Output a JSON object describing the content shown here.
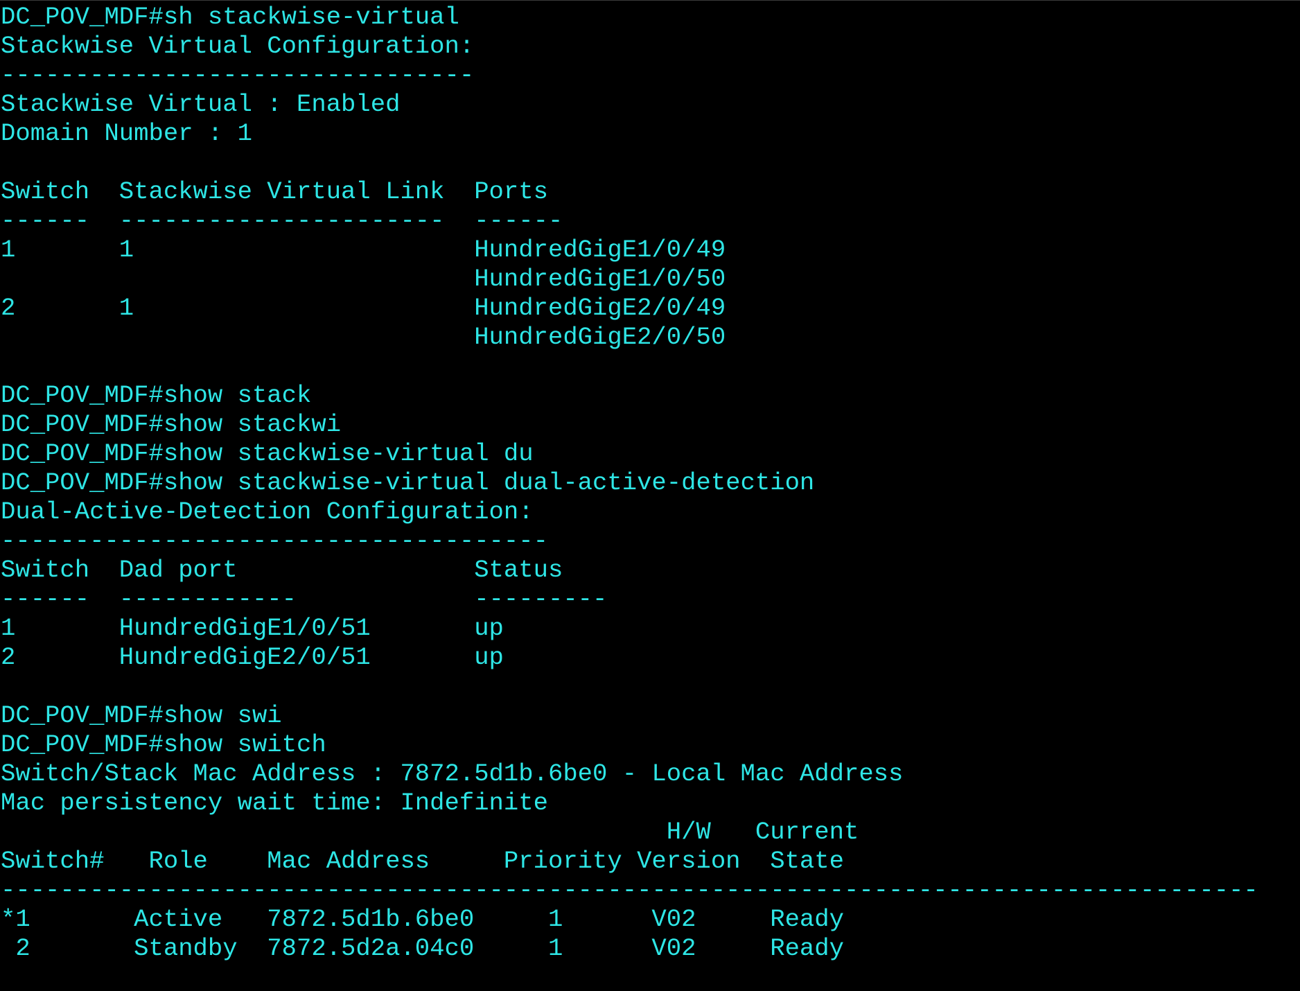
{
  "terminal": {
    "lines": [
      "DC_POV_MDF#sh stackwise-virtual",
      "Stackwise Virtual Configuration:",
      "--------------------------------",
      "Stackwise Virtual : Enabled",
      "Domain Number : 1",
      "",
      "Switch  Stackwise Virtual Link  Ports",
      "------  ----------------------  ------",
      "1       1                       HundredGigE1/0/49",
      "                                HundredGigE1/0/50",
      "2       1                       HundredGigE2/0/49",
      "                                HundredGigE2/0/50",
      "",
      "DC_POV_MDF#show stack",
      "DC_POV_MDF#show stackwi",
      "DC_POV_MDF#show stackwise-virtual du",
      "DC_POV_MDF#show stackwise-virtual dual-active-detection",
      "Dual-Active-Detection Configuration:",
      "-------------------------------------",
      "Switch  Dad port                Status",
      "------  ------------            ---------",
      "1       HundredGigE1/0/51       up",
      "2       HundredGigE2/0/51       up",
      "",
      "DC_POV_MDF#show swi",
      "DC_POV_MDF#show switch",
      "Switch/Stack Mac Address : 7872.5d1b.6be0 - Local Mac Address",
      "Mac persistency wait time: Indefinite",
      "                                             H/W   Current",
      "Switch#   Role    Mac Address     Priority Version  State",
      "-------------------------------------------------------------------------------------",
      "*1       Active   7872.5d1b.6be0     1      V02     Ready",
      " 2       Standby  7872.5d2a.04c0     1      V02     Ready"
    ]
  },
  "colors": {
    "background": "#000000",
    "text": "#2ee6e6"
  }
}
